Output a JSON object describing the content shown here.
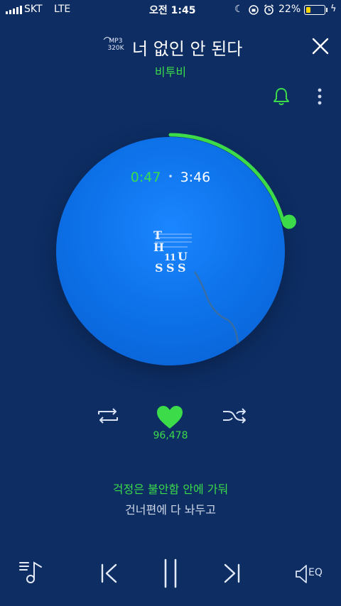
{
  "status_bar": {
    "carrier": "SKT",
    "network": "LTE",
    "time": "오전 1:45",
    "battery_percent": "22%",
    "battery_level": 0.22,
    "icons": [
      "moon-icon",
      "orientation-lock-icon",
      "alarm-icon",
      "charging-icon"
    ]
  },
  "header": {
    "quality_format": "MP3",
    "quality_bitrate": "320K",
    "title": "너 없인 안 된다",
    "artist": "비투비"
  },
  "player": {
    "current_time": "0:47",
    "separator": "•",
    "total_time": "3:46",
    "progress": 0.208,
    "album_logo_letters": [
      "T",
      "H",
      "1",
      "1",
      "U",
      "S",
      "S",
      "S"
    ],
    "like_count": "96,478",
    "liked": true
  },
  "lyrics": {
    "current_line": "걱정은 불안함 안에 가둬",
    "next_line": "건너편에 다 놔두고"
  },
  "controls": {
    "eq_label": "EQ"
  },
  "colors": {
    "background": "#0d2d63",
    "accent_green": "#3bdb4a",
    "disc_blue": "#1a86ff"
  }
}
